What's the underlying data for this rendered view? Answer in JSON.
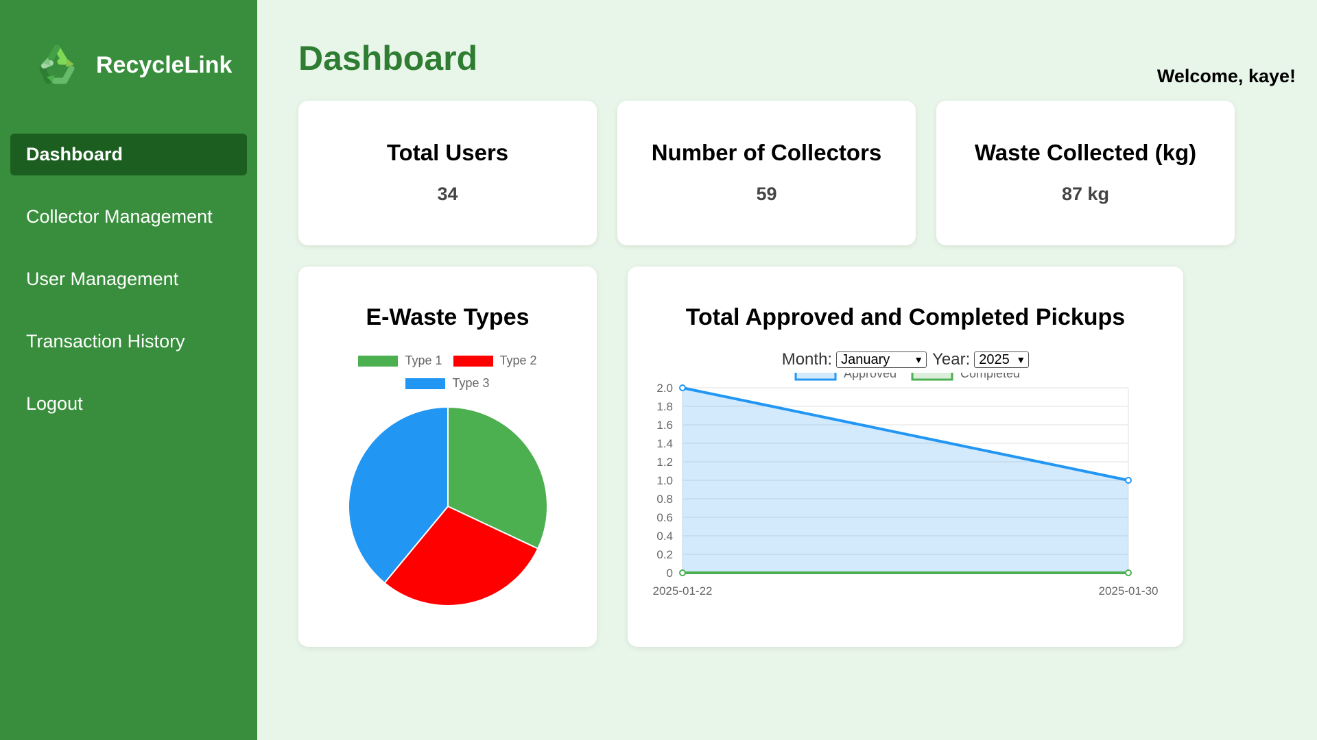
{
  "app": {
    "name": "RecycleLink"
  },
  "sidebar": {
    "items": [
      {
        "label": "Dashboard",
        "active": true
      },
      {
        "label": "Collector Management"
      },
      {
        "label": "User Management"
      },
      {
        "label": "Transaction History"
      },
      {
        "label": "Logout"
      }
    ]
  },
  "header": {
    "title": "Dashboard",
    "welcome": "Welcome, kaye!"
  },
  "stats": [
    {
      "title": "Total Users",
      "value": "34"
    },
    {
      "title": "Number of Collectors",
      "value": "59"
    },
    {
      "title": "Waste Collected (kg)",
      "value": "87 kg"
    }
  ],
  "pie": {
    "title": "E-Waste Types",
    "chart_data": {
      "type": "pie",
      "labels": [
        "Type 1",
        "Type 2",
        "Type 3"
      ],
      "values": [
        32,
        29,
        39
      ],
      "colors": [
        "#4caf50",
        "#ff0000",
        "#2196f3"
      ]
    }
  },
  "pickups": {
    "title": "Total Approved and Completed Pickups",
    "month_label": "Month:",
    "month_value": "January",
    "year_label": "Year:",
    "year_value": "2025",
    "chart_data": {
      "type": "line",
      "x": [
        "2025-01-22",
        "2025-01-30"
      ],
      "series": [
        {
          "name": "Approved",
          "values": [
            2,
            1
          ],
          "color": "#2196f3",
          "fill": true
        },
        {
          "name": "Completed",
          "values": [
            0,
            0
          ],
          "color": "#4caf50",
          "fill": false
        }
      ],
      "ylim": [
        0,
        2
      ],
      "yticks": [
        "0",
        "0.2",
        "0.4",
        "0.6",
        "0.8",
        "1.0",
        "1.2",
        "1.4",
        "1.6",
        "1.8",
        "2.0"
      ],
      "grid": true,
      "legend": "top"
    }
  },
  "colors": {
    "sidebar": "#388e3c",
    "active": "#1b5e20",
    "accent": "#2e7d32",
    "background": "#e8f5e9"
  }
}
